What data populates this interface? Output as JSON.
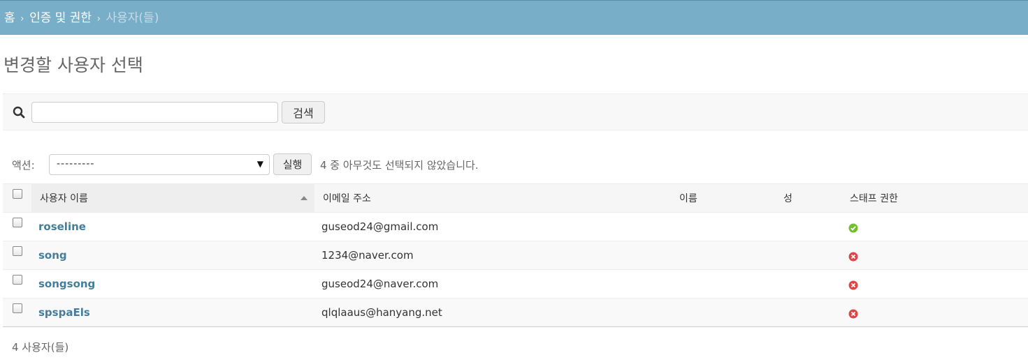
{
  "breadcrumbs": {
    "home": "홈",
    "app": "인증 및 권한",
    "current": "사용자(들)",
    "separator": "›"
  },
  "page_title": "변경할 사용자 선택",
  "search": {
    "value": "",
    "button_label": "검색"
  },
  "actions": {
    "label": "액션:",
    "selected": "---------",
    "go_label": "실행",
    "counter": "4 중 아무것도 선택되지 않았습니다."
  },
  "table": {
    "columns": [
      "사용자 이름",
      "이메일 주소",
      "이름",
      "성",
      "스태프 권한"
    ],
    "rows": [
      {
        "username": "roseline",
        "email": "guseod24@gmail.com",
        "first_name": "",
        "last_name": "",
        "is_staff": true
      },
      {
        "username": "song",
        "email": "1234@naver.com",
        "first_name": "",
        "last_name": "",
        "is_staff": false
      },
      {
        "username": "songsong",
        "email": "guseod24@naver.com",
        "first_name": "",
        "last_name": "",
        "is_staff": false
      },
      {
        "username": "spspaEls",
        "email": "qlqlaaus@hanyang.net",
        "first_name": "",
        "last_name": "",
        "is_staff": false
      }
    ]
  },
  "paginator": "4 사용자(들)",
  "colors": {
    "header_bg": "#79aec8",
    "link": "#447e9b",
    "yes": "#70bf2b",
    "no": "#dd4646"
  },
  "icons": {
    "search": "search-icon",
    "yes": "check-circle-icon",
    "no": "x-circle-icon"
  }
}
